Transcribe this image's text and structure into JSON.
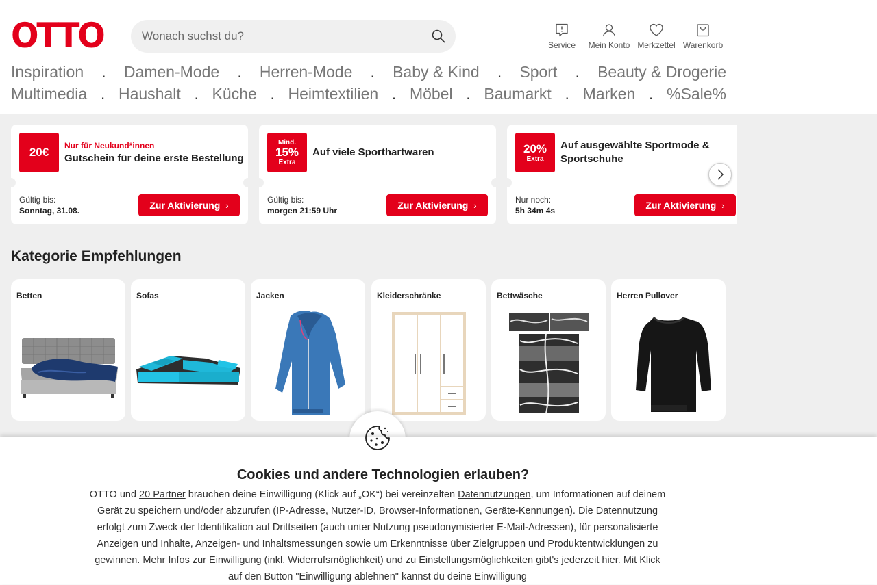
{
  "header": {
    "logo": "OTTO",
    "search_placeholder": "Wonach suchst du?",
    "actions": {
      "service": "Service",
      "konto": "Mein Konto",
      "merkzettel": "Merkzettel",
      "warenkorb": "Warenkorb"
    }
  },
  "nav": {
    "row1": [
      "Inspiration",
      "Damen-Mode",
      "Herren-Mode",
      "Baby & Kind",
      "Sport",
      "Beauty & Drogerie"
    ],
    "row2": [
      "Multimedia",
      "Haushalt",
      "Küche",
      "Heimtextilien",
      "Möbel",
      "Baumarkt",
      "Marken",
      "%Sale%"
    ],
    "separator": "."
  },
  "coupons": [
    {
      "badge_big": "20€",
      "kicker": "Nur für Neukund*innen",
      "headline": "Gutschein für deine erste Bestellung",
      "valid_label": "Gültig bis:",
      "valid_value": "Sonntag, 31.08.",
      "cta": "Zur Aktivierung"
    },
    {
      "badge_top": "Mind.",
      "badge_big": "15%",
      "badge_bottom": "Extra",
      "headline": "Auf viele Sporthartwaren",
      "valid_label": "Gültig bis:",
      "valid_value": "morgen 21:59 Uhr",
      "cta": "Zur Aktivierung"
    },
    {
      "badge_big": "20%",
      "badge_bottom": "Extra",
      "headline_line1": "Auf ausgewählte Sportmode &",
      "headline_line2": "Sportschuhe",
      "valid_label": "Nur noch:",
      "valid_value": "5h 34m 4s",
      "cta": "Zur Aktivierung"
    }
  ],
  "recommendations": {
    "title": "Kategorie Empfehlungen",
    "items": [
      "Betten",
      "Sofas",
      "Jacken",
      "Kleiderschränke",
      "Bettwäsche",
      "Herren Pullover"
    ]
  },
  "cookie": {
    "title": "Cookies und andere Technologien erlauben?",
    "t1": "OTTO und ",
    "link_partner": "20 Partner",
    "t2": " brauchen deine Einwilligung (Klick auf „OK“) bei vereinzelten ",
    "link_datennutzungen": "Datennutzungen",
    "t3": ", um Informationen auf deinem Gerät zu speichern und/oder abzurufen (IP-Adresse, Nutzer-ID, Browser-Informationen, Geräte-Kennungen). Die Datennutzung erfolgt zum Zweck der Identifikation auf Drittseiten (auch unter Nutzung pseudonymisierter E-Mail-Adressen), für personalisierte Anzeigen und Inhalte, Anzeigen- und Inhaltsmessungen sowie um Erkenntnisse über Zielgruppen und Produktentwicklungen zu gewinnen. Mehr Infos zur Einwilligung (inkl. Widerrufsmöglichkeit) und zu Einstellungsmöglichkeiten gibt's jederzeit ",
    "link_hier": "hier",
    "t4": ". Mit Klick auf den Button \"Einwilligung ablehnen\" kannst du deine Einwilligung"
  },
  "colors": {
    "brand": "#e3001b",
    "grey_bg": "#efefef"
  }
}
